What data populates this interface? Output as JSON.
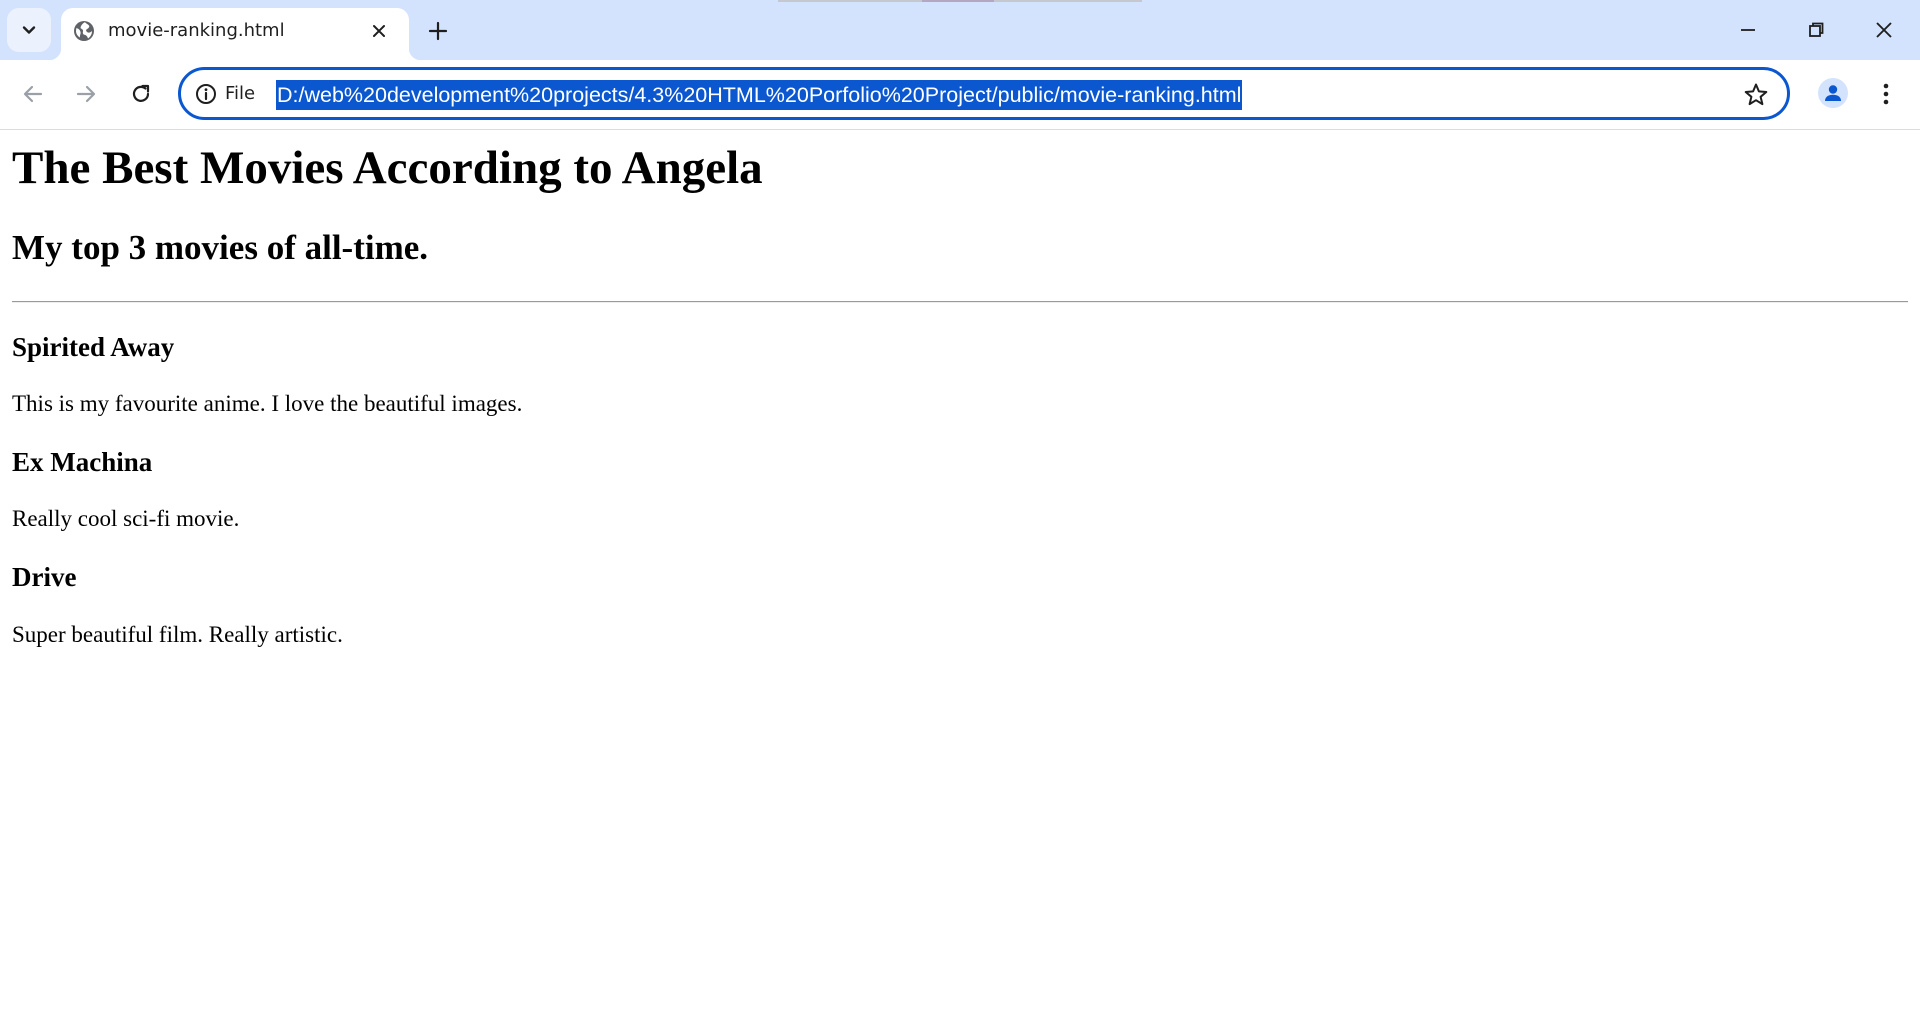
{
  "browser": {
    "tab": {
      "title": "movie-ranking.html",
      "favicon": "globe-icon"
    },
    "address_bar": {
      "scheme_label": "File",
      "url": "D:/web%20development%20projects/4.3%20HTML%20Porfolio%20Project/public/movie-ranking.html"
    },
    "colors": {
      "tabstrip_bg": "#d3e3fd",
      "accent": "#0b57d0",
      "page_bg": "#ffffff"
    }
  },
  "page": {
    "heading": "The Best Movies According to Angela",
    "subheading": "My top 3 movies of all-time.",
    "movies": [
      {
        "title": "Spirited Away",
        "description": "This is my favourite anime. I love the beautiful images."
      },
      {
        "title": "Ex Machina",
        "description": "Really cool sci-fi movie."
      },
      {
        "title": "Drive",
        "description": "Super beautiful film. Really artistic."
      }
    ]
  }
}
